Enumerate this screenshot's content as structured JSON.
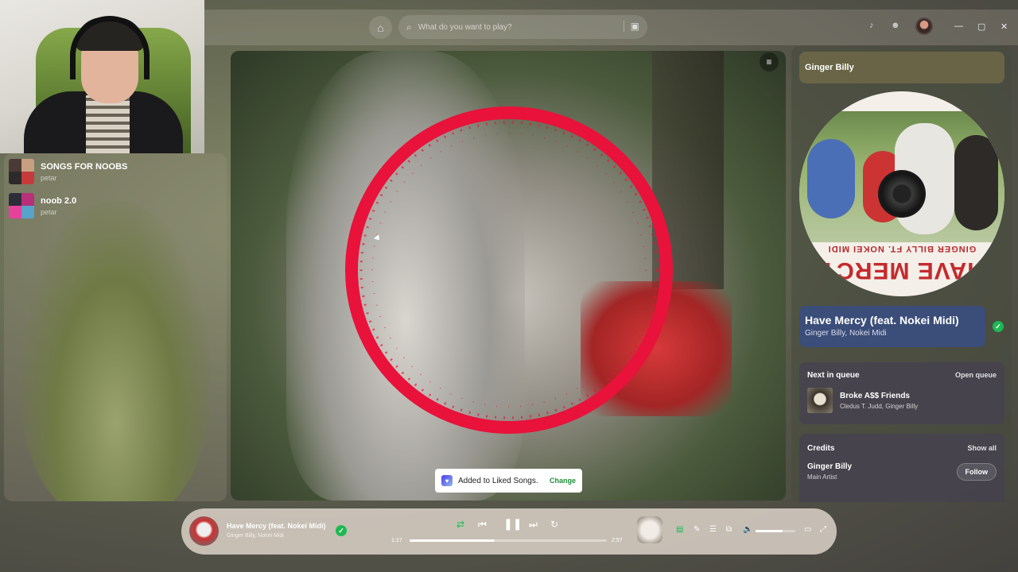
{
  "colors": {
    "accent": "#1db954",
    "visualizer": "#e8123a",
    "now_playing_card": "#3b4d79"
  },
  "library": {
    "items": [
      {
        "title": "SONGS FOR NOOBS",
        "owner": "petar"
      },
      {
        "title": "noob 2.0",
        "owner": "petar"
      }
    ]
  },
  "topbar": {
    "search_placeholder": "What do you want to play?",
    "icons": [
      "home-icon",
      "search-icon",
      "browse-icon",
      "bell-icon",
      "friends-icon"
    ]
  },
  "toast": {
    "text": "Added to Liked Songs.",
    "action": "Change"
  },
  "right_panel": {
    "header_title": "Ginger Billy",
    "cover_small_text": "GINGER BILLY FT. NOKEI MIDI",
    "cover_big_text": "HAVE MERCY",
    "now_playing": {
      "title": "Have Mercy (feat. Nokei Midi)",
      "artists": "Ginger Billy, Nokei Midi"
    },
    "queue": {
      "heading": "Next in queue",
      "open_label": "Open queue",
      "track": {
        "title": "Broke A$$ Friends",
        "artists": "Cledus T. Judd, Ginger Billy"
      }
    },
    "credits": {
      "heading": "Credits",
      "show_all_label": "Show all",
      "person": {
        "name": "Ginger Billy",
        "role": "Main Artist"
      },
      "follow_label": "Follow"
    }
  },
  "player": {
    "title": "Have Mercy (feat. Nokei Midi)",
    "artists": "Ginger Billy, Nokei Midi",
    "elapsed": "1:17",
    "duration": "2:57",
    "progress": 0.43,
    "volume": 0.67
  }
}
